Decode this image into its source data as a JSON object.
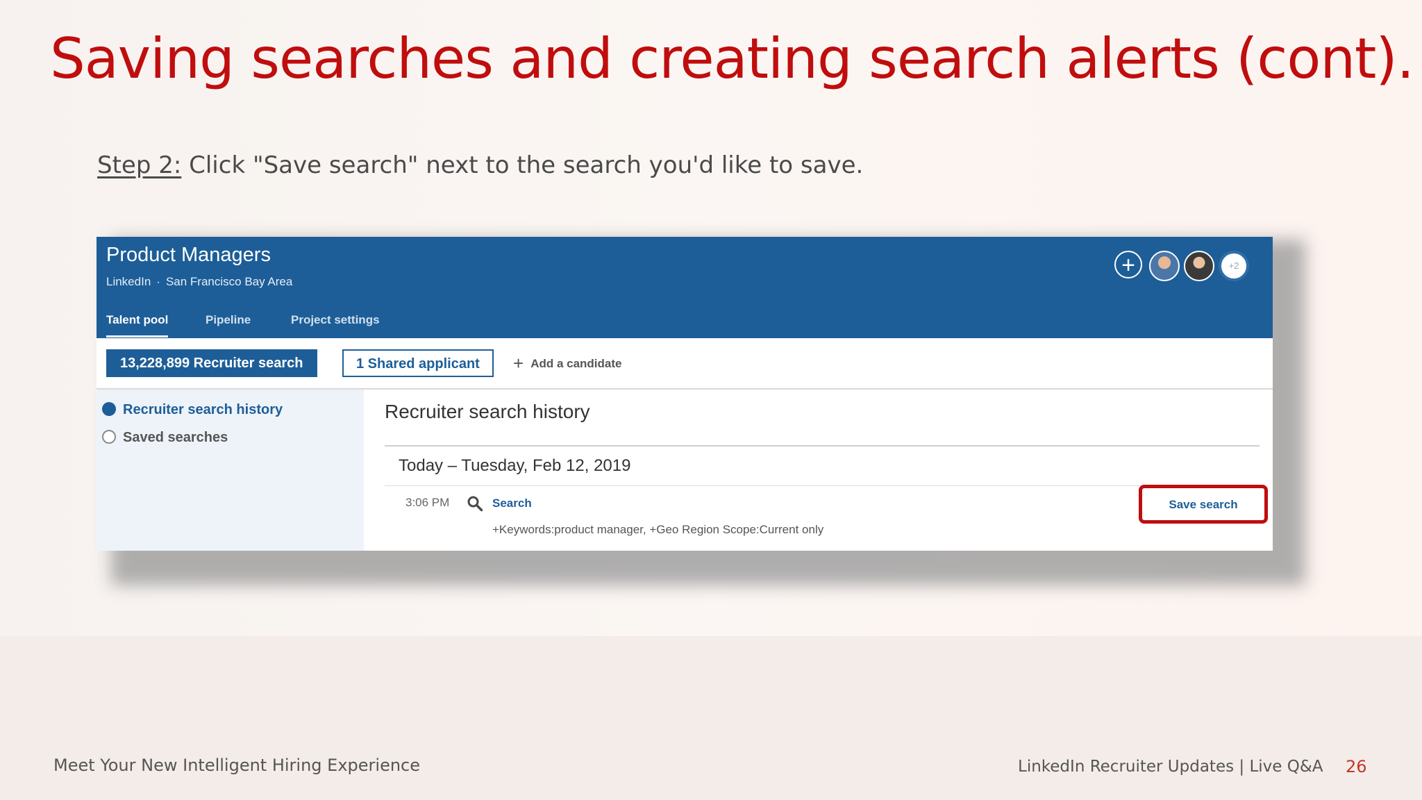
{
  "slide": {
    "title": "Saving searches and creating search alerts (cont).",
    "step_label": "Step 2:",
    "step_text": " Click \"Save search\" next to the search you'd like to save."
  },
  "recruiter": {
    "project_title": "Product Managers",
    "company": "LinkedIn",
    "location": "San Francisco Bay Area",
    "separator": "·",
    "tabs": [
      {
        "label": "Talent pool",
        "active": true
      },
      {
        "label": "Pipeline",
        "active": false
      },
      {
        "label": "Project settings",
        "active": false
      }
    ],
    "extra_members": "+2",
    "actions": {
      "recruiter_search": "13,228,899 Recruiter search",
      "shared_applicant": "1 Shared applicant",
      "add_candidate": "Add a candidate"
    },
    "sidebar": {
      "items": [
        {
          "label": "Recruiter search history",
          "selected": true
        },
        {
          "label": "Saved searches",
          "selected": false
        }
      ]
    },
    "history": {
      "title": "Recruiter search history",
      "date_header": "Today – Tuesday, Feb 12, 2019",
      "entry": {
        "time": "3:06 PM",
        "link": "Search",
        "criteria": "+Keywords:product manager, +Geo Region Scope:Current only",
        "save_label": "Save search"
      }
    },
    "colors": {
      "brand": "#1d5e98",
      "highlight": "#c00d0d"
    }
  },
  "footer": {
    "left": "Meet Your New Intelligent Hiring Experience",
    "right": "LinkedIn Recruiter Updates | Live Q&A",
    "page": "26"
  }
}
